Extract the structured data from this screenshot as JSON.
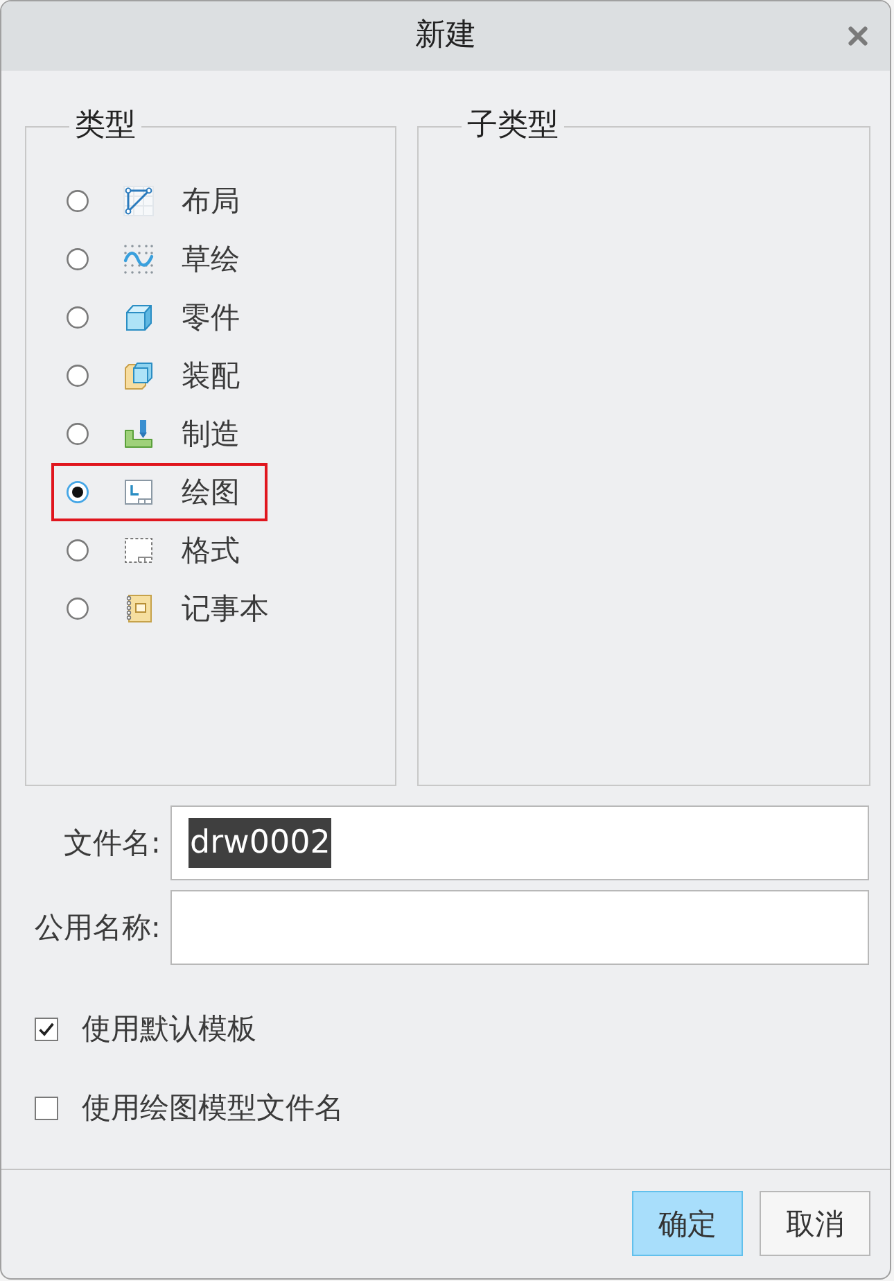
{
  "window": {
    "title": "新建"
  },
  "types": {
    "title": "类型",
    "items": [
      {
        "label": "布局",
        "selected": false,
        "highlighted": false
      },
      {
        "label": "草绘",
        "selected": false,
        "highlighted": false
      },
      {
        "label": "零件",
        "selected": false,
        "highlighted": false
      },
      {
        "label": "装配",
        "selected": false,
        "highlighted": false
      },
      {
        "label": "制造",
        "selected": false,
        "highlighted": false
      },
      {
        "label": "绘图",
        "selected": true,
        "highlighted": true
      },
      {
        "label": "格式",
        "selected": false,
        "highlighted": false
      },
      {
        "label": "记事本",
        "selected": false,
        "highlighted": false
      }
    ]
  },
  "subtypes": {
    "title": "子类型"
  },
  "fields": [
    {
      "label": "文件名:",
      "value": "drw0002",
      "value_selected": true
    },
    {
      "label": "公用名称:"
    }
  ],
  "options": [
    {
      "label": "使用默认模板",
      "checked": true
    },
    {
      "label": "使用绘图模型文件名",
      "checked": false
    }
  ],
  "buttons": [
    {
      "label": "确定",
      "primary": true
    },
    {
      "label": "取消",
      "primary": false
    }
  ]
}
